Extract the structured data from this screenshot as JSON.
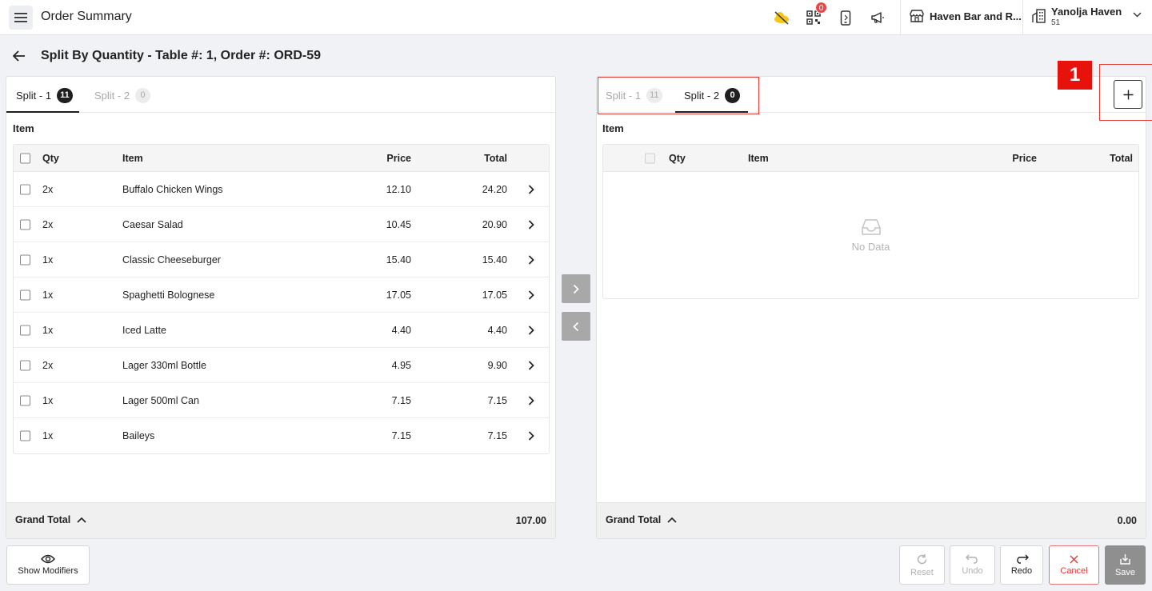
{
  "header": {
    "title": "Order Summary",
    "notifications_count": "0",
    "store_name": "Haven Bar and R...",
    "user_name": "Yanolja Haven",
    "user_sub": "51"
  },
  "page": {
    "title": "Split By Quantity - Table #: 1, Order #: ORD-59"
  },
  "left_panel": {
    "tabs": [
      {
        "label": "Split - 1",
        "count": "11"
      },
      {
        "label": "Split - 2",
        "count": "0"
      }
    ],
    "section_label": "Item",
    "columns": {
      "qty": "Qty",
      "item": "Item",
      "price": "Price",
      "total": "Total"
    },
    "rows": [
      {
        "qty": "2x",
        "item": "Buffalo Chicken Wings",
        "price": "12.10",
        "total": "24.20"
      },
      {
        "qty": "2x",
        "item": "Caesar Salad",
        "price": "10.45",
        "total": "20.90"
      },
      {
        "qty": "1x",
        "item": "Classic Cheeseburger",
        "price": "15.40",
        "total": "15.40"
      },
      {
        "qty": "1x",
        "item": "Spaghetti Bolognese",
        "price": "17.05",
        "total": "17.05"
      },
      {
        "qty": "1x",
        "item": "Iced Latte",
        "price": "4.40",
        "total": "4.40"
      },
      {
        "qty": "2x",
        "item": "Lager 330ml Bottle",
        "price": "4.95",
        "total": "9.90"
      },
      {
        "qty": "1x",
        "item": "Lager 500ml Can",
        "price": "7.15",
        "total": "7.15"
      },
      {
        "qty": "1x",
        "item": "Baileys",
        "price": "7.15",
        "total": "7.15"
      }
    ],
    "grand_total_label": "Grand Total",
    "grand_total_value": "107.00"
  },
  "right_panel": {
    "tabs": [
      {
        "label": "Split - 1",
        "count": "11"
      },
      {
        "label": "Split - 2",
        "count": "0"
      }
    ],
    "section_label": "Item",
    "columns": {
      "qty": "Qty",
      "item": "Item",
      "price": "Price",
      "total": "Total"
    },
    "empty_text": "No Data",
    "grand_total_label": "Grand Total",
    "grand_total_value": "0.00"
  },
  "annotation": {
    "marker": "1"
  },
  "footer": {
    "show_modifiers": "Show Modifiers",
    "reset": "Reset",
    "undo": "Undo",
    "redo": "Redo",
    "cancel": "Cancel",
    "save": "Save"
  },
  "colors": {
    "highlight": "#e53935",
    "marker_bg": "#e8120c",
    "active_badge": "#1f1f1f",
    "transfer_button": "#a8a8a8",
    "save_button": "#8f8f8f"
  },
  "icons": [
    "menu-icon",
    "weather-icon",
    "qr-code-icon",
    "mobile-icon",
    "megaphone-icon",
    "store-icon",
    "building-icon",
    "chevron-down-icon",
    "back-arrow-icon",
    "chevron-right-icon",
    "chevron-left-icon",
    "chevron-up-icon",
    "inbox-icon",
    "plus-icon",
    "eye-icon",
    "reset-icon",
    "undo-icon",
    "redo-icon",
    "close-icon",
    "save-icon"
  ]
}
